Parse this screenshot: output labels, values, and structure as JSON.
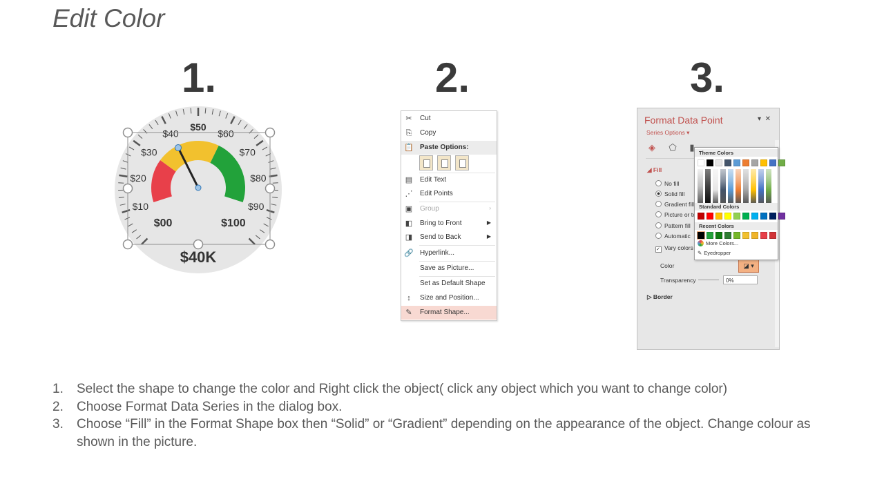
{
  "title": "Edit Color",
  "steps": [
    "1.",
    "2.",
    "3."
  ],
  "gauge": {
    "value_label": "$40K",
    "ticks": [
      "$00",
      "$10",
      "$20",
      "$30",
      "$40",
      "$50",
      "$60",
      "$70",
      "$80",
      "$90",
      "$100"
    ],
    "value": 40,
    "max": 100,
    "colors": {
      "red": "#e8404a",
      "yellow": "#f2c12e",
      "green": "#22a23a",
      "face": "#e6e6e6"
    }
  },
  "context_menu": {
    "items": [
      {
        "label": "Cut",
        "icon": "scissors-icon",
        "glyph": "✂"
      },
      {
        "label": "Copy",
        "icon": "copy-icon",
        "glyph": "⎘"
      },
      {
        "label": "Paste Options:",
        "icon": "paste-icon",
        "glyph": "📋"
      },
      {
        "label": "Edit Text",
        "icon": "edit-text-icon",
        "glyph": "▤"
      },
      {
        "label": "Edit Points",
        "icon": "edit-points-icon",
        "glyph": "⋰"
      },
      {
        "label": "Group",
        "icon": "group-icon",
        "glyph": "▣"
      },
      {
        "label": "Bring to Front",
        "icon": "bring-to-front-icon",
        "glyph": "◧"
      },
      {
        "label": "Send to Back",
        "icon": "send-to-back-icon",
        "glyph": "◨"
      },
      {
        "label": "Hyperlink...",
        "icon": "hyperlink-icon",
        "glyph": "🔗"
      },
      {
        "label": "Save as Picture...",
        "icon": "",
        "glyph": ""
      },
      {
        "label": "Set as Default Shape",
        "icon": "",
        "glyph": ""
      },
      {
        "label": "Size and Position...",
        "icon": "size-position-icon",
        "glyph": "↕"
      },
      {
        "label": "Format Shape...",
        "icon": "format-shape-icon",
        "glyph": "✎"
      }
    ]
  },
  "format_pane": {
    "title": "Format Data Point",
    "subtitle": "Series Options ▾",
    "fill_label": "Fill",
    "options": [
      "No fill",
      "Solid fill",
      "Gradient fill",
      "Picture or te",
      "Pattern fill",
      "Automatic",
      "Vary colors b"
    ],
    "color_label": "Color",
    "transparency_label": "Transparency",
    "transparency_value": "0%",
    "border_label": "Border"
  },
  "color_popup": {
    "theme_header": "Theme Colors",
    "standard_header": "Standard Colors",
    "recent_header": "Recent Colors",
    "more_colors": "More Colors...",
    "eyedropper": "Eyedropper",
    "theme_colors": [
      "#ffffff",
      "#000000",
      "#e7e6e6",
      "#44546a",
      "#5b9bd5",
      "#ed7d31",
      "#a5a5a5",
      "#ffc000",
      "#4472c4",
      "#70ad47"
    ],
    "standard_colors": [
      "#c00000",
      "#ff0000",
      "#ffc000",
      "#ffff00",
      "#92d050",
      "#00b050",
      "#00b0f0",
      "#0070c0",
      "#002060",
      "#7030a0"
    ],
    "recent_colors": [
      "#000000",
      "#22a23a",
      "#107c10",
      "#2e7d32",
      "#76b82a",
      "#f2c12e",
      "#f0b429",
      "#e8404a",
      "#d13438"
    ]
  },
  "instructions": [
    {
      "n": "1.",
      "text": "Select the shape to change the color and Right click the object( click any object which you want to change color)"
    },
    {
      "n": "2.",
      "text": "Choose Format Data Series in the dialog box."
    },
    {
      "n": "3.",
      "text": "Choose “Fill” in the Format Shape box then “Solid” or “Gradient” depending on the appearance of the object. Change colour as shown in the picture."
    }
  ]
}
